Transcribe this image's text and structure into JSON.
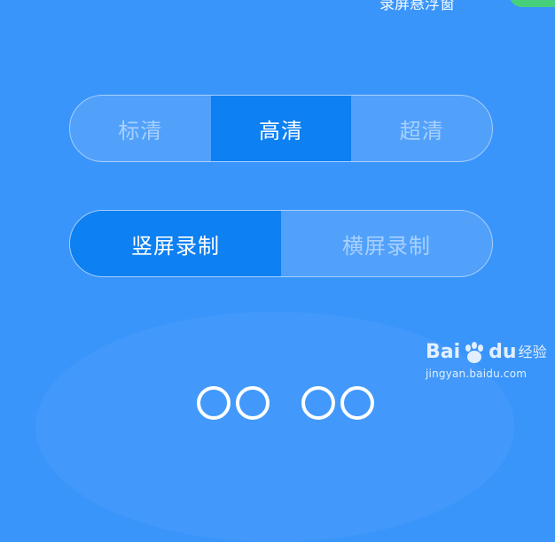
{
  "status": {
    "top_text": "录屏悬浮窗"
  },
  "quality": {
    "options": [
      "标清",
      "高清",
      "超清"
    ],
    "selected": "高清"
  },
  "orientation": {
    "options": [
      "竖屏录制",
      "横屏录制"
    ],
    "selected": "竖屏录制"
  },
  "watermark": {
    "brand_left": "Bai",
    "brand_right": "du",
    "brand_cn": "经验",
    "url": "jingyan.baidu.com"
  },
  "colors": {
    "background": "#3a95fb",
    "active_segment": "#0d80f2",
    "toggle_on": "#46d07c"
  }
}
